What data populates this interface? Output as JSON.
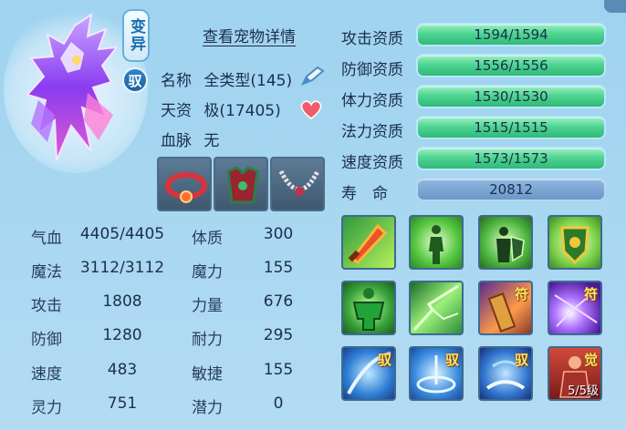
{
  "pet": {
    "badge_transform": "变异",
    "badge_tame": "驭",
    "detail_link": "查看宠物详情",
    "name_label": "名称",
    "name_value": "全类型(145)",
    "talent_label": "天资",
    "talent_value": "极(17405)",
    "bloodline_label": "血脉",
    "bloodline_value": "无"
  },
  "stats": [
    {
      "label": "气血",
      "value": "4405/4405",
      "label2": "体质",
      "value2": "300"
    },
    {
      "label": "魔法",
      "value": "3112/3112",
      "label2": "魔力",
      "value2": "155"
    },
    {
      "label": "攻击",
      "value": "1808",
      "label2": "力量",
      "value2": "676"
    },
    {
      "label": "防御",
      "value": "1280",
      "label2": "耐力",
      "value2": "295"
    },
    {
      "label": "速度",
      "value": "483",
      "label2": "敏捷",
      "value2": "155"
    },
    {
      "label": "灵力",
      "value": "751",
      "label2": "潜力",
      "value2": "0"
    }
  ],
  "aptitudes": [
    {
      "label": "攻击资质",
      "value": "1594/1594",
      "fill": 1.0
    },
    {
      "label": "防御资质",
      "value": "1556/1556",
      "fill": 1.0
    },
    {
      "label": "体力资质",
      "value": "1530/1530",
      "fill": 1.0
    },
    {
      "label": "法力资质",
      "value": "1515/1515",
      "fill": 1.0
    },
    {
      "label": "速度资质",
      "value": "1573/1573",
      "fill": 1.0
    }
  ],
  "lifespan": {
    "label": "寿　命",
    "value": "20812"
  },
  "equipment": [
    {
      "icon": "red-collar-icon"
    },
    {
      "icon": "armor-vest-icon"
    },
    {
      "icon": "bead-necklace-icon"
    }
  ],
  "skills": [
    {
      "icon": "flame-sword-icon",
      "tag": ""
    },
    {
      "icon": "green-figure-icon",
      "tag": ""
    },
    {
      "icon": "shield-warrior-icon",
      "tag": ""
    },
    {
      "icon": "gold-shield-icon",
      "tag": ""
    },
    {
      "icon": "green-giant-icon",
      "tag": ""
    },
    {
      "icon": "green-crack-icon",
      "tag": ""
    },
    {
      "icon": "talisman-scroll-icon",
      "tag": "符"
    },
    {
      "icon": "purple-burst-icon",
      "tag": "符"
    },
    {
      "icon": "blue-slash-icon",
      "tag": "驭"
    },
    {
      "icon": "blue-vortex-icon",
      "tag": "驭"
    },
    {
      "icon": "blue-arc-icon",
      "tag": "驭"
    },
    {
      "icon": "red-awaken-icon",
      "tag": "觉",
      "level": "5/5级"
    }
  ]
}
